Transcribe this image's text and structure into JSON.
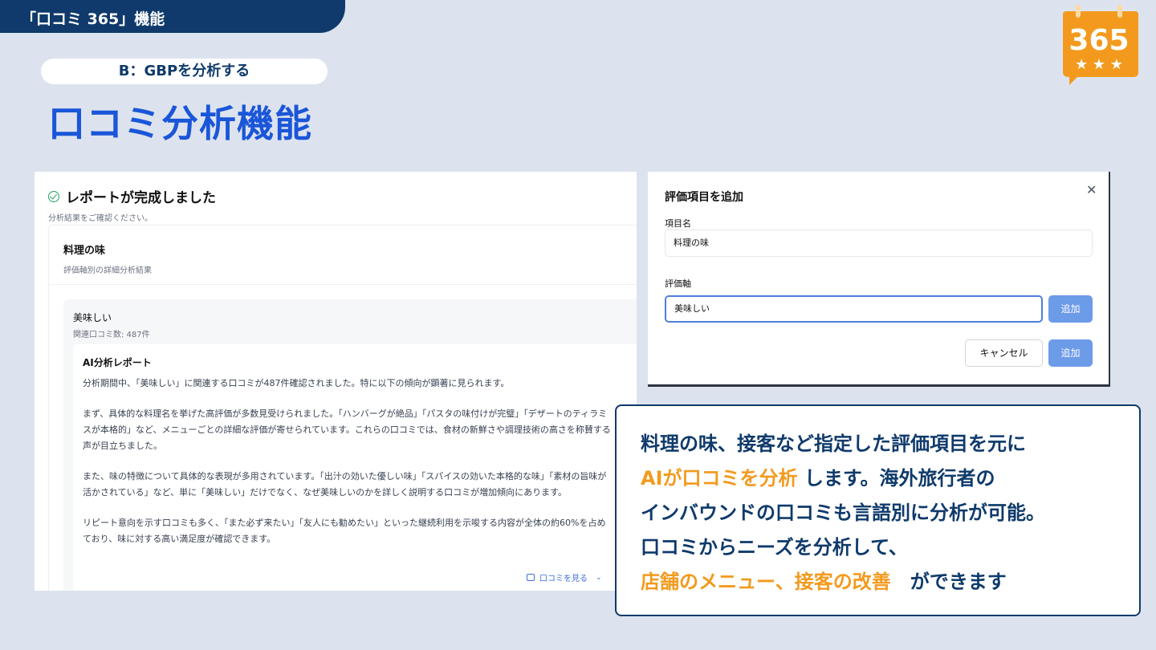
{
  "header": {
    "tab_label": "「口コミ 365」機能"
  },
  "logo": {
    "number": "365",
    "stars": "★ ★ ★",
    "accent": "#f39a1e"
  },
  "section": {
    "pill_label": "B：GBPを分析する",
    "title": "口コミ分析機能"
  },
  "report": {
    "title": "レポートが完成しました",
    "subtitle": "分析結果をご確認ください。",
    "card_title": "料理の味",
    "card_subtitle": "評価軸別の詳細分析結果",
    "axis_name": "美味しい",
    "axis_count": "関連口コミ数: 487件",
    "ai_title": "AI分析レポート",
    "paragraphs": [
      "分析期間中、「美味しい」に関連する口コミが487件確認されました。特に以下の傾向が顕著に見られます。",
      "まず、具体的な料理名を挙げた高評価が多数見受けられました。「ハンバーグが絶品」「パスタの味付けが完璧」「デザートのティラミスが本格的」など、メニューごとの詳細な評価が寄せられています。これらの口コミでは、食材の新鮮さや調理技術の高さを称賛する声が目立ちました。",
      "また、味の特徴について具体的な表現が多用されています。「出汁の効いた優しい味」「スパイスの効いた本格的な味」「素材の旨味が活かされている」など、単に「美味しい」だけでなく、なぜ美味しいのかを詳しく説明する口コミが増加傾向にあります。",
      "リピート意向を示す口コミも多く、「また必ず来たい」「友人にも勧めたい」といった継続利用を示唆する内容が全体の約60%を占めており、味に対する高い満足度が確認できます。"
    ],
    "see_reviews": "口コミを見る"
  },
  "modal": {
    "title": "評価項目を追加",
    "item_label": "項目名",
    "item_value": "料理の味",
    "axis_label": "評価軸",
    "axis_value": "美味しい",
    "add_label": "追加",
    "cancel_label": "キャンセル",
    "submit_label": "追加"
  },
  "callout": {
    "line1": "料理の味、接客など指定した評価項目を元に",
    "line2_highlight": "AIが口コミを分析",
    "line2_rest": " します。海外旅行者の",
    "line3": "インバウンドの口コミも言語別に分析が可能。",
    "line4": "口コミからニーズを分析して、",
    "line5_highlight": "店舗のメニュー、接客の改善",
    "line5_rest": "　ができます"
  }
}
